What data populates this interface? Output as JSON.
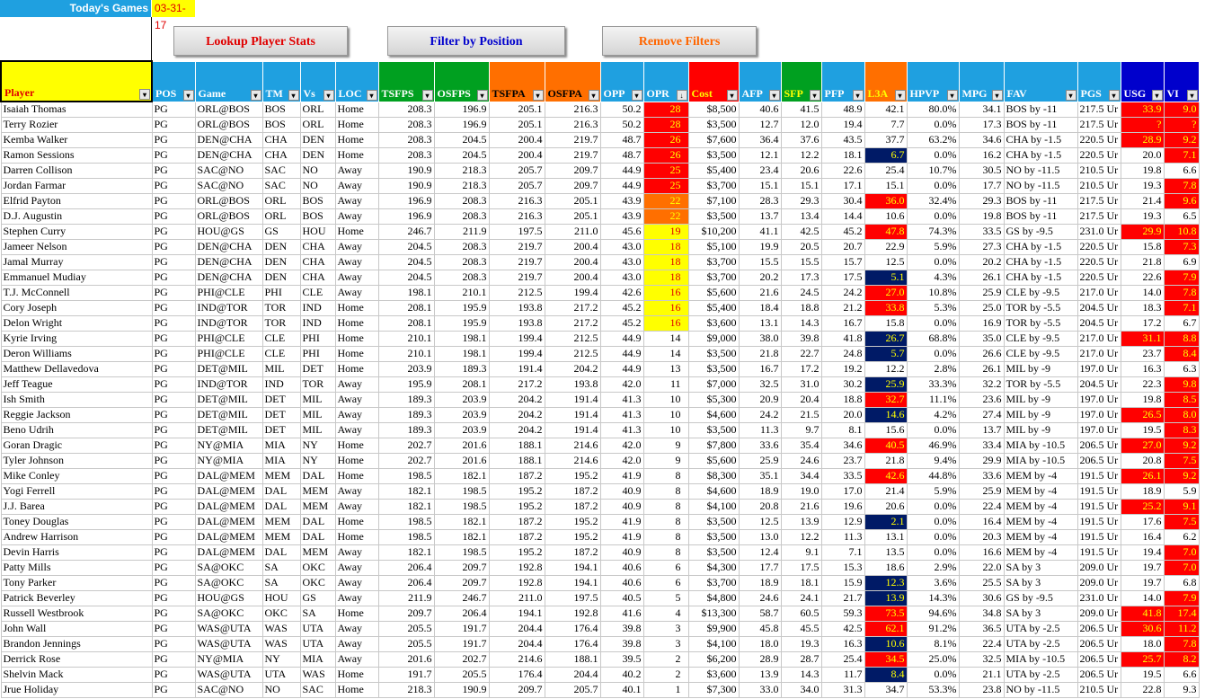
{
  "top": {
    "todays_games_label": "Today's Games",
    "date": "03-31-17"
  },
  "buttons": [
    {
      "label": "Lookup Player Stats",
      "color": "#e00000"
    },
    {
      "label": "Filter by Position",
      "color": "#0000cc"
    },
    {
      "label": "Remove Filters",
      "color": "#ff6600"
    }
  ],
  "columns": [
    {
      "label": "Player",
      "bg": "#ffff00",
      "fg": "#e00000",
      "filter_icon": "filter-dropdown-icon"
    },
    {
      "label": "POS",
      "bg": "#1fa0e0",
      "fg": "#ffffff",
      "filter_icon": "filter-active-icon"
    },
    {
      "label": "Game",
      "bg": "#1fa0e0",
      "fg": "#ffffff",
      "filter_icon": "filter-dropdown-icon"
    },
    {
      "label": "TM",
      "bg": "#1fa0e0",
      "fg": "#ffffff",
      "filter_icon": "filter-dropdown-icon"
    },
    {
      "label": "Vs",
      "bg": "#1fa0e0",
      "fg": "#ffffff",
      "filter_icon": "filter-dropdown-icon"
    },
    {
      "label": "LOC",
      "bg": "#1fa0e0",
      "fg": "#ffffff",
      "filter_icon": "filter-dropdown-icon"
    },
    {
      "label": "TSFPS",
      "bg": "#00a020",
      "fg": "#ffffff",
      "filter_icon": "filter-dropdown-icon"
    },
    {
      "label": "OSFPS",
      "bg": "#00a020",
      "fg": "#ffffff",
      "filter_icon": "filter-dropdown-icon"
    },
    {
      "label": "TSFPA",
      "bg": "#ff6f00",
      "fg": "#000000",
      "filter_icon": "filter-dropdown-icon"
    },
    {
      "label": "OSFPA",
      "bg": "#ff6f00",
      "fg": "#000000",
      "filter_icon": "filter-dropdown-icon"
    },
    {
      "label": "OPP",
      "bg": "#1fa0e0",
      "fg": "#ffffff",
      "filter_icon": "filter-dropdown-icon"
    },
    {
      "label": "OPR",
      "bg": "#1fa0e0",
      "fg": "#ffffff",
      "filter_icon": "sort-desc-icon"
    },
    {
      "label": "Cost",
      "bg": "#ff0000",
      "fg": "#ffff00",
      "filter_icon": "filter-dropdown-icon"
    },
    {
      "label": "AFP",
      "bg": "#1fa0e0",
      "fg": "#ffffff",
      "filter_icon": "filter-dropdown-icon"
    },
    {
      "label": "SFP",
      "bg": "#00a020",
      "fg": "#ffff00",
      "filter_icon": "filter-dropdown-icon"
    },
    {
      "label": "PFP",
      "bg": "#1fa0e0",
      "fg": "#ffffff",
      "filter_icon": "filter-dropdown-icon"
    },
    {
      "label": "L3A",
      "bg": "#ff6f00",
      "fg": "#ffff00",
      "filter_icon": "filter-dropdown-icon"
    },
    {
      "label": "HPVP",
      "bg": "#1fa0e0",
      "fg": "#ffffff",
      "filter_icon": "filter-dropdown-icon"
    },
    {
      "label": "MPG",
      "bg": "#1fa0e0",
      "fg": "#ffffff",
      "filter_icon": "filter-dropdown-icon"
    },
    {
      "label": "FAV",
      "bg": "#1fa0e0",
      "fg": "#ffffff",
      "filter_icon": "filter-dropdown-icon"
    },
    {
      "label": "PGS",
      "bg": "#1fa0e0",
      "fg": "#ffffff",
      "filter_icon": "filter-dropdown-icon"
    },
    {
      "label": "USG",
      "bg": "#0000cc",
      "fg": "#ffffff",
      "filter_icon": "filter-dropdown-icon"
    },
    {
      "label": "VI",
      "bg": "#0000cc",
      "fg": "#ffffff",
      "filter_icon": "filter-dropdown-icon"
    }
  ],
  "rows": [
    [
      "Isaiah Thomas",
      "PG",
      "ORL@BOS",
      "BOS",
      "ORL",
      "Home",
      "208.3",
      "196.9",
      "205.1",
      "216.3",
      "50.2",
      "28",
      "$8,500",
      "40.6",
      "41.5",
      "48.9",
      "42.1",
      "80.0%",
      "34.1",
      "BOS by -11",
      "217.5 Ur",
      "33.9",
      "9.0"
    ],
    [
      "Terry Rozier",
      "PG",
      "ORL@BOS",
      "BOS",
      "ORL",
      "Home",
      "208.3",
      "196.9",
      "205.1",
      "216.3",
      "50.2",
      "28",
      "$3,500",
      "12.7",
      "12.0",
      "19.4",
      "7.7",
      "0.0%",
      "17.3",
      "BOS by -11",
      "217.5 Ur",
      "?",
      "?"
    ],
    [
      "Kemba Walker",
      "PG",
      "DEN@CHA",
      "CHA",
      "DEN",
      "Home",
      "208.3",
      "204.5",
      "200.4",
      "219.7",
      "48.7",
      "26",
      "$7,600",
      "36.4",
      "37.6",
      "43.5",
      "37.7",
      "63.2%",
      "34.6",
      "CHA by -1.5",
      "220.5 Ur",
      "28.9",
      "9.2"
    ],
    [
      "Ramon Sessions",
      "PG",
      "DEN@CHA",
      "CHA",
      "DEN",
      "Home",
      "208.3",
      "204.5",
      "200.4",
      "219.7",
      "48.7",
      "26",
      "$3,500",
      "12.1",
      "12.2",
      "18.1",
      "6.7",
      "0.0%",
      "16.2",
      "CHA by -1.5",
      "220.5 Ur",
      "20.0",
      "7.1"
    ],
    [
      "Darren Collison",
      "PG",
      "SAC@NO",
      "SAC",
      "NO",
      "Away",
      "190.9",
      "218.3",
      "205.7",
      "209.7",
      "44.9",
      "25",
      "$5,400",
      "23.4",
      "20.6",
      "22.6",
      "25.4",
      "10.7%",
      "30.5",
      "NO by -11.5",
      "210.5 Ur",
      "19.8",
      "6.6"
    ],
    [
      "Jordan Farmar",
      "PG",
      "SAC@NO",
      "SAC",
      "NO",
      "Away",
      "190.9",
      "218.3",
      "205.7",
      "209.7",
      "44.9",
      "25",
      "$3,700",
      "15.1",
      "15.1",
      "17.1",
      "15.1",
      "0.0%",
      "17.7",
      "NO by -11.5",
      "210.5 Ur",
      "19.3",
      "7.8"
    ],
    [
      "Elfrid Payton",
      "PG",
      "ORL@BOS",
      "ORL",
      "BOS",
      "Away",
      "196.9",
      "208.3",
      "216.3",
      "205.1",
      "43.9",
      "22",
      "$7,100",
      "28.3",
      "29.3",
      "30.4",
      "36.0",
      "32.4%",
      "29.3",
      "BOS by -11",
      "217.5 Ur",
      "21.4",
      "9.6"
    ],
    [
      "D.J. Augustin",
      "PG",
      "ORL@BOS",
      "ORL",
      "BOS",
      "Away",
      "196.9",
      "208.3",
      "216.3",
      "205.1",
      "43.9",
      "22",
      "$3,500",
      "13.7",
      "13.4",
      "14.4",
      "10.6",
      "0.0%",
      "19.8",
      "BOS by -11",
      "217.5 Ur",
      "19.3",
      "6.5"
    ],
    [
      "Stephen Curry",
      "PG",
      "HOU@GS",
      "GS",
      "HOU",
      "Home",
      "246.7",
      "211.9",
      "197.5",
      "211.0",
      "45.6",
      "19",
      "$10,200",
      "41.1",
      "42.5",
      "45.2",
      "47.8",
      "74.3%",
      "33.5",
      "GS by -9.5",
      "231.0 Ur",
      "29.9",
      "10.8"
    ],
    [
      "Jameer Nelson",
      "PG",
      "DEN@CHA",
      "DEN",
      "CHA",
      "Away",
      "204.5",
      "208.3",
      "219.7",
      "200.4",
      "43.0",
      "18",
      "$5,100",
      "19.9",
      "20.5",
      "20.7",
      "22.9",
      "5.9%",
      "27.3",
      "CHA by -1.5",
      "220.5 Ur",
      "15.8",
      "7.3"
    ],
    [
      "Jamal Murray",
      "PG",
      "DEN@CHA",
      "DEN",
      "CHA",
      "Away",
      "204.5",
      "208.3",
      "219.7",
      "200.4",
      "43.0",
      "18",
      "$3,700",
      "15.5",
      "15.5",
      "15.7",
      "12.5",
      "0.0%",
      "20.2",
      "CHA by -1.5",
      "220.5 Ur",
      "21.8",
      "6.9"
    ],
    [
      "Emmanuel Mudiay",
      "PG",
      "DEN@CHA",
      "DEN",
      "CHA",
      "Away",
      "204.5",
      "208.3",
      "219.7",
      "200.4",
      "43.0",
      "18",
      "$3,700",
      "20.2",
      "17.3",
      "17.5",
      "5.1",
      "4.3%",
      "26.1",
      "CHA by -1.5",
      "220.5 Ur",
      "22.6",
      "7.9"
    ],
    [
      "T.J. McConnell",
      "PG",
      "PHI@CLE",
      "PHI",
      "CLE",
      "Away",
      "198.1",
      "210.1",
      "212.5",
      "199.4",
      "42.6",
      "16",
      "$5,600",
      "21.6",
      "24.5",
      "24.2",
      "27.0",
      "10.8%",
      "25.9",
      "CLE by -9.5",
      "217.0 Ur",
      "14.0",
      "7.8"
    ],
    [
      "Cory Joseph",
      "PG",
      "IND@TOR",
      "TOR",
      "IND",
      "Home",
      "208.1",
      "195.9",
      "193.8",
      "217.2",
      "45.2",
      "16",
      "$5,400",
      "18.4",
      "18.8",
      "21.2",
      "33.8",
      "5.3%",
      "25.0",
      "TOR by -5.5",
      "204.5 Ur",
      "18.3",
      "7.1"
    ],
    [
      "Delon Wright",
      "PG",
      "IND@TOR",
      "TOR",
      "IND",
      "Home",
      "208.1",
      "195.9",
      "193.8",
      "217.2",
      "45.2",
      "16",
      "$3,600",
      "13.1",
      "14.3",
      "16.7",
      "15.8",
      "0.0%",
      "16.9",
      "TOR by -5.5",
      "204.5 Ur",
      "17.2",
      "6.7"
    ],
    [
      "Kyrie Irving",
      "PG",
      "PHI@CLE",
      "CLE",
      "PHI",
      "Home",
      "210.1",
      "198.1",
      "199.4",
      "212.5",
      "44.9",
      "14",
      "$9,000",
      "38.0",
      "39.8",
      "41.8",
      "26.7",
      "68.8%",
      "35.0",
      "CLE by -9.5",
      "217.0 Ur",
      "31.1",
      "8.8"
    ],
    [
      "Deron Williams",
      "PG",
      "PHI@CLE",
      "CLE",
      "PHI",
      "Home",
      "210.1",
      "198.1",
      "199.4",
      "212.5",
      "44.9",
      "14",
      "$3,500",
      "21.8",
      "22.7",
      "24.8",
      "5.7",
      "0.0%",
      "26.6",
      "CLE by -9.5",
      "217.0 Ur",
      "23.7",
      "8.4"
    ],
    [
      "Matthew Dellavedova",
      "PG",
      "DET@MIL",
      "MIL",
      "DET",
      "Home",
      "203.9",
      "189.3",
      "191.4",
      "204.2",
      "44.9",
      "13",
      "$3,500",
      "16.7",
      "17.2",
      "19.2",
      "12.2",
      "2.8%",
      "26.1",
      "MIL by -9",
      "197.0 Ur",
      "16.3",
      "6.3"
    ],
    [
      "Jeff Teague",
      "PG",
      "IND@TOR",
      "IND",
      "TOR",
      "Away",
      "195.9",
      "208.1",
      "217.2",
      "193.8",
      "42.0",
      "11",
      "$7,000",
      "32.5",
      "31.0",
      "30.2",
      "25.9",
      "33.3%",
      "32.2",
      "TOR by -5.5",
      "204.5 Ur",
      "22.3",
      "9.8"
    ],
    [
      "Ish Smith",
      "PG",
      "DET@MIL",
      "DET",
      "MIL",
      "Away",
      "189.3",
      "203.9",
      "204.2",
      "191.4",
      "41.3",
      "10",
      "$5,300",
      "20.9",
      "20.4",
      "18.8",
      "32.7",
      "11.1%",
      "23.6",
      "MIL by -9",
      "197.0 Ur",
      "19.8",
      "8.5"
    ],
    [
      "Reggie Jackson",
      "PG",
      "DET@MIL",
      "DET",
      "MIL",
      "Away",
      "189.3",
      "203.9",
      "204.2",
      "191.4",
      "41.3",
      "10",
      "$4,600",
      "24.2",
      "21.5",
      "20.0",
      "14.6",
      "4.2%",
      "27.4",
      "MIL by -9",
      "197.0 Ur",
      "26.5",
      "8.0"
    ],
    [
      "Beno Udrih",
      "PG",
      "DET@MIL",
      "DET",
      "MIL",
      "Away",
      "189.3",
      "203.9",
      "204.2",
      "191.4",
      "41.3",
      "10",
      "$3,500",
      "11.3",
      "9.7",
      "8.1",
      "15.6",
      "0.0%",
      "13.7",
      "MIL by -9",
      "197.0 Ur",
      "19.5",
      "8.3"
    ],
    [
      "Goran Dragic",
      "PG",
      "NY@MIA",
      "MIA",
      "NY",
      "Home",
      "202.7",
      "201.6",
      "188.1",
      "214.6",
      "42.0",
      "9",
      "$7,800",
      "33.6",
      "35.4",
      "34.6",
      "40.5",
      "46.9%",
      "33.4",
      "MIA by -10.5",
      "206.5 Ur",
      "27.0",
      "9.2"
    ],
    [
      "Tyler Johnson",
      "PG",
      "NY@MIA",
      "MIA",
      "NY",
      "Home",
      "202.7",
      "201.6",
      "188.1",
      "214.6",
      "42.0",
      "9",
      "$5,600",
      "25.9",
      "24.6",
      "23.7",
      "21.8",
      "9.4%",
      "29.9",
      "MIA by -10.5",
      "206.5 Ur",
      "20.8",
      "7.5"
    ],
    [
      "Mike Conley",
      "PG",
      "DAL@MEM",
      "MEM",
      "DAL",
      "Home",
      "198.5",
      "182.1",
      "187.2",
      "195.2",
      "41.9",
      "8",
      "$8,300",
      "35.1",
      "34.4",
      "33.5",
      "42.6",
      "44.8%",
      "33.6",
      "MEM by -4",
      "191.5 Ur",
      "26.1",
      "9.2"
    ],
    [
      "Yogi Ferrell",
      "PG",
      "DAL@MEM",
      "DAL",
      "MEM",
      "Away",
      "182.1",
      "198.5",
      "195.2",
      "187.2",
      "40.9",
      "8",
      "$4,600",
      "18.9",
      "19.0",
      "17.0",
      "21.4",
      "5.9%",
      "25.9",
      "MEM by -4",
      "191.5 Ur",
      "18.9",
      "5.9"
    ],
    [
      "J.J. Barea",
      "PG",
      "DAL@MEM",
      "DAL",
      "MEM",
      "Away",
      "182.1",
      "198.5",
      "195.2",
      "187.2",
      "40.9",
      "8",
      "$4,100",
      "20.8",
      "21.6",
      "19.6",
      "20.6",
      "0.0%",
      "22.4",
      "MEM by -4",
      "191.5 Ur",
      "25.2",
      "9.1"
    ],
    [
      "Toney Douglas",
      "PG",
      "DAL@MEM",
      "MEM",
      "DAL",
      "Home",
      "198.5",
      "182.1",
      "187.2",
      "195.2",
      "41.9",
      "8",
      "$3,500",
      "12.5",
      "13.9",
      "12.9",
      "2.1",
      "0.0%",
      "16.4",
      "MEM by -4",
      "191.5 Ur",
      "17.6",
      "7.5"
    ],
    [
      "Andrew Harrison",
      "PG",
      "DAL@MEM",
      "MEM",
      "DAL",
      "Home",
      "198.5",
      "182.1",
      "187.2",
      "195.2",
      "41.9",
      "8",
      "$3,500",
      "13.0",
      "12.2",
      "11.3",
      "13.1",
      "0.0%",
      "20.3",
      "MEM by -4",
      "191.5 Ur",
      "16.4",
      "6.2"
    ],
    [
      "Devin Harris",
      "PG",
      "DAL@MEM",
      "DAL",
      "MEM",
      "Away",
      "182.1",
      "198.5",
      "195.2",
      "187.2",
      "40.9",
      "8",
      "$3,500",
      "12.4",
      "9.1",
      "7.1",
      "13.5",
      "0.0%",
      "16.6",
      "MEM by -4",
      "191.5 Ur",
      "19.4",
      "7.0"
    ],
    [
      "Patty Mills",
      "PG",
      "SA@OKC",
      "SA",
      "OKC",
      "Away",
      "206.4",
      "209.7",
      "192.8",
      "194.1",
      "40.6",
      "6",
      "$4,300",
      "17.7",
      "17.5",
      "15.3",
      "18.6",
      "2.9%",
      "22.0",
      "SA by 3",
      "209.0 Ur",
      "19.7",
      "7.0"
    ],
    [
      "Tony Parker",
      "PG",
      "SA@OKC",
      "SA",
      "OKC",
      "Away",
      "206.4",
      "209.7",
      "192.8",
      "194.1",
      "40.6",
      "6",
      "$3,700",
      "18.9",
      "18.1",
      "15.9",
      "12.3",
      "3.6%",
      "25.5",
      "SA by 3",
      "209.0 Ur",
      "19.7",
      "6.8"
    ],
    [
      "Patrick Beverley",
      "PG",
      "HOU@GS",
      "HOU",
      "GS",
      "Away",
      "211.9",
      "246.7",
      "211.0",
      "197.5",
      "40.5",
      "5",
      "$4,800",
      "24.6",
      "24.1",
      "21.7",
      "13.9",
      "14.3%",
      "30.6",
      "GS by -9.5",
      "231.0 Ur",
      "14.0",
      "7.9"
    ],
    [
      "Russell Westbrook",
      "PG",
      "SA@OKC",
      "OKC",
      "SA",
      "Home",
      "209.7",
      "206.4",
      "194.1",
      "192.8",
      "41.6",
      "4",
      "$13,300",
      "58.7",
      "60.5",
      "59.3",
      "73.5",
      "94.6%",
      "34.8",
      "SA by 3",
      "209.0 Ur",
      "41.8",
      "17.4"
    ],
    [
      "John Wall",
      "PG",
      "WAS@UTA",
      "WAS",
      "UTA",
      "Away",
      "205.5",
      "191.7",
      "204.4",
      "176.4",
      "39.8",
      "3",
      "$9,900",
      "45.8",
      "45.5",
      "42.5",
      "62.1",
      "91.2%",
      "36.5",
      "UTA by -2.5",
      "206.5 Ur",
      "30.6",
      "11.2"
    ],
    [
      "Brandon Jennings",
      "PG",
      "WAS@UTA",
      "WAS",
      "UTA",
      "Away",
      "205.5",
      "191.7",
      "204.4",
      "176.4",
      "39.8",
      "3",
      "$4,100",
      "18.0",
      "19.3",
      "16.3",
      "10.6",
      "8.1%",
      "22.4",
      "UTA by -2.5",
      "206.5 Ur",
      "18.0",
      "7.8"
    ],
    [
      "Derrick Rose",
      "PG",
      "NY@MIA",
      "NY",
      "MIA",
      "Away",
      "201.6",
      "202.7",
      "214.6",
      "188.1",
      "39.5",
      "2",
      "$6,200",
      "28.9",
      "28.7",
      "25.4",
      "34.5",
      "25.0%",
      "32.5",
      "MIA by -10.5",
      "206.5 Ur",
      "25.7",
      "8.2"
    ],
    [
      "Shelvin Mack",
      "PG",
      "WAS@UTA",
      "UTA",
      "WAS",
      "Home",
      "191.7",
      "205.5",
      "176.4",
      "204.4",
      "40.2",
      "2",
      "$3,600",
      "13.9",
      "14.3",
      "11.7",
      "8.4",
      "0.0%",
      "21.1",
      "UTA by -2.5",
      "206.5 Ur",
      "19.5",
      "6.6"
    ],
    [
      "Jrue Holiday",
      "PG",
      "SAC@NO",
      "NO",
      "SAC",
      "Home",
      "218.3",
      "190.9",
      "209.7",
      "205.7",
      "40.1",
      "1",
      "$7,300",
      "33.0",
      "34.0",
      "31.3",
      "34.7",
      "53.3%",
      "23.8",
      "NO by -11.5",
      "210.5 Ur",
      "22.8",
      "9.3"
    ]
  ],
  "highlights": {
    "opr": [
      "red",
      "red",
      "red",
      "red",
      "red",
      "red",
      "org",
      "org",
      "yel",
      "yel",
      "yel",
      "yel",
      "yel",
      "yel",
      "yel",
      "",
      "",
      "",
      "",
      "",
      "",
      "",
      "",
      "",
      "",
      "",
      "",
      "",
      "",
      "",
      "",
      "",
      "",
      "",
      "",
      "",
      "",
      "",
      ""
    ],
    "l3a": [
      "",
      "",
      "",
      "nav",
      "",
      "",
      "red",
      "",
      "red",
      "",
      "",
      "nav",
      "red",
      "red",
      "",
      "nav",
      "nav",
      "",
      "nav",
      "red",
      "nav",
      "",
      "red",
      "",
      "red",
      "",
      "",
      "nav",
      "",
      "",
      "",
      "nav",
      "nav",
      "red",
      "red",
      "nav",
      "red",
      "nav",
      ""
    ],
    "usg": [
      "red",
      "red",
      "red",
      "",
      "",
      "",
      "",
      "",
      "red",
      "",
      "",
      "",
      "",
      "",
      "",
      "red",
      "",
      "",
      "",
      "",
      "red",
      "",
      "red",
      "",
      "red",
      "",
      "red",
      "",
      "",
      "",
      "",
      "",
      "",
      "red",
      "red",
      "",
      "red",
      "",
      ""
    ],
    "vi": [
      "red",
      "red",
      "red",
      "red",
      "",
      "red",
      "red",
      "",
      "red",
      "red",
      "",
      "red",
      "red",
      "red",
      "",
      "red",
      "red",
      "",
      "red",
      "red",
      "red",
      "red",
      "red",
      "red",
      "red",
      "",
      "red",
      "red",
      "",
      "red",
      "red",
      "",
      "red",
      "red",
      "red",
      "red",
      "red",
      "",
      ""
    ]
  }
}
